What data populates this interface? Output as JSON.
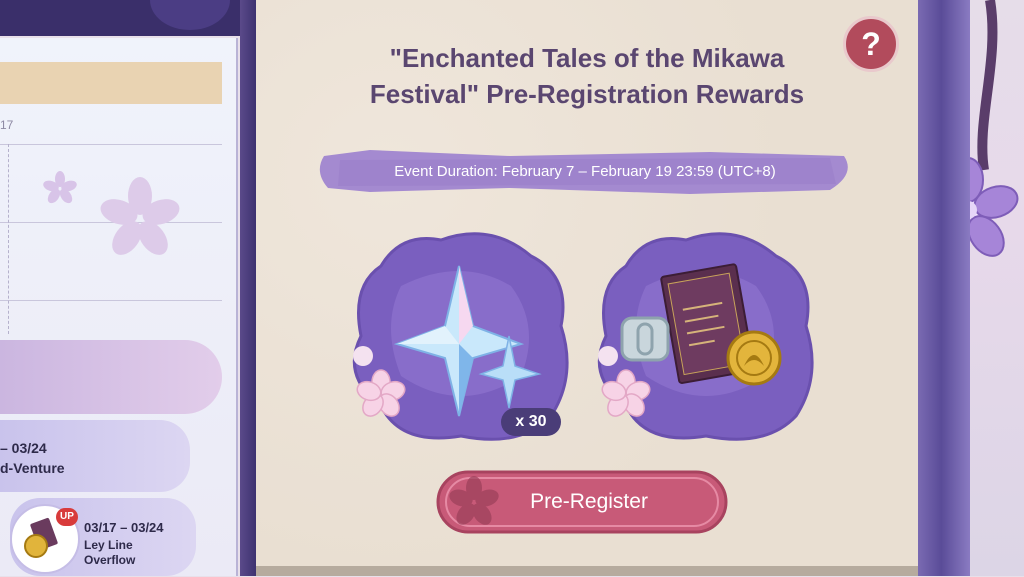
{
  "header": {
    "title_line1": "\"Enchanted Tales of the Mikawa",
    "title_line2": "Festival\" Pre-Registration Rewards",
    "help_symbol": "?"
  },
  "event": {
    "duration": "Event Duration: February 7 – February 19 23:59 (UTC+8)"
  },
  "rewards": [
    {
      "icon": "primogem-icon",
      "quantity": "x 30"
    },
    {
      "icon": "book-coin-bundle-icon"
    }
  ],
  "actions": {
    "pre_register_label": "Pre-Register"
  },
  "calendar": {
    "partial_date": "17",
    "item1_date": "– 03/24",
    "item1_name": "d-Venture",
    "item2_badge": "UP",
    "item2_date": "03/17 – 03/24",
    "item2_name_line1": "Ley Line",
    "item2_name_line2": "Overflow"
  },
  "colors": {
    "title": "#5a4670",
    "accent_pink": "#c85a78",
    "help_button": "#b24b5c",
    "banner_purple": "#a48ad0"
  }
}
